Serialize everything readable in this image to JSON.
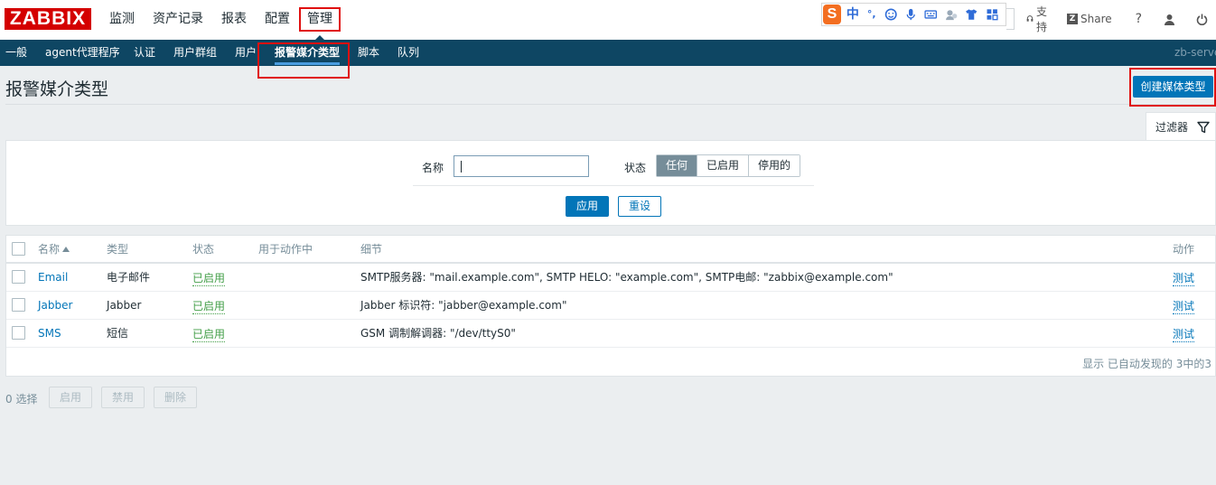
{
  "header": {
    "logo": "ZABBIX",
    "menu": [
      {
        "label": "监测"
      },
      {
        "label": "资产记录"
      },
      {
        "label": "报表"
      },
      {
        "label": "配置"
      },
      {
        "label": "管理"
      }
    ],
    "ime": {
      "logo": "S",
      "lang": "中",
      "punct": "°,"
    },
    "support_label": "支持",
    "share_label": "Share",
    "help_label": "?"
  },
  "subnav": {
    "items": [
      {
        "label": "一般"
      },
      {
        "label": "agent代理程序"
      },
      {
        "label": "认证"
      },
      {
        "label": "用户群组"
      },
      {
        "label": "用户"
      },
      {
        "label": "报警媒介类型"
      },
      {
        "label": "脚本"
      },
      {
        "label": "队列"
      }
    ],
    "server": "zb-server"
  },
  "page": {
    "title": "报警媒介类型",
    "create_button": "创建媒体类型"
  },
  "filter": {
    "tab_label": "过滤器",
    "name_label": "名称",
    "name_value": "",
    "status_label": "状态",
    "status_options": [
      "任何",
      "已启用",
      "停用的"
    ],
    "status_selected": "任何",
    "apply_label": "应用",
    "reset_label": "重设"
  },
  "table": {
    "columns": [
      "名称",
      "类型",
      "状态",
      "用于动作中",
      "细节",
      "动作"
    ],
    "rows": [
      {
        "name": "Email",
        "type": "电子邮件",
        "status": "已启用",
        "used_in_actions": "",
        "details": "SMTP服务器: \"mail.example.com\", SMTP HELO: \"example.com\", SMTP电邮: \"zabbix@example.com\"",
        "action": "测试"
      },
      {
        "name": "Jabber",
        "type": "Jabber",
        "status": "已启用",
        "used_in_actions": "",
        "details": "Jabber 标识符: \"jabber@example.com\"",
        "action": "测试"
      },
      {
        "name": "SMS",
        "type": "短信",
        "status": "已启用",
        "used_in_actions": "",
        "details": "GSM 调制解调器: \"/dev/ttyS0\"",
        "action": "测试"
      }
    ],
    "footer": "显示 已自动发现的 3中的3"
  },
  "bulk": {
    "selected": "0 选择",
    "enable": "启用",
    "disable": "禁用",
    "delete": "删除"
  },
  "colors": {
    "brand_red": "#d40000",
    "nav_bg": "#0e4663",
    "accent_blue": "#0275b8",
    "status_green": "#429e47",
    "highlight_red": "#e01010"
  }
}
